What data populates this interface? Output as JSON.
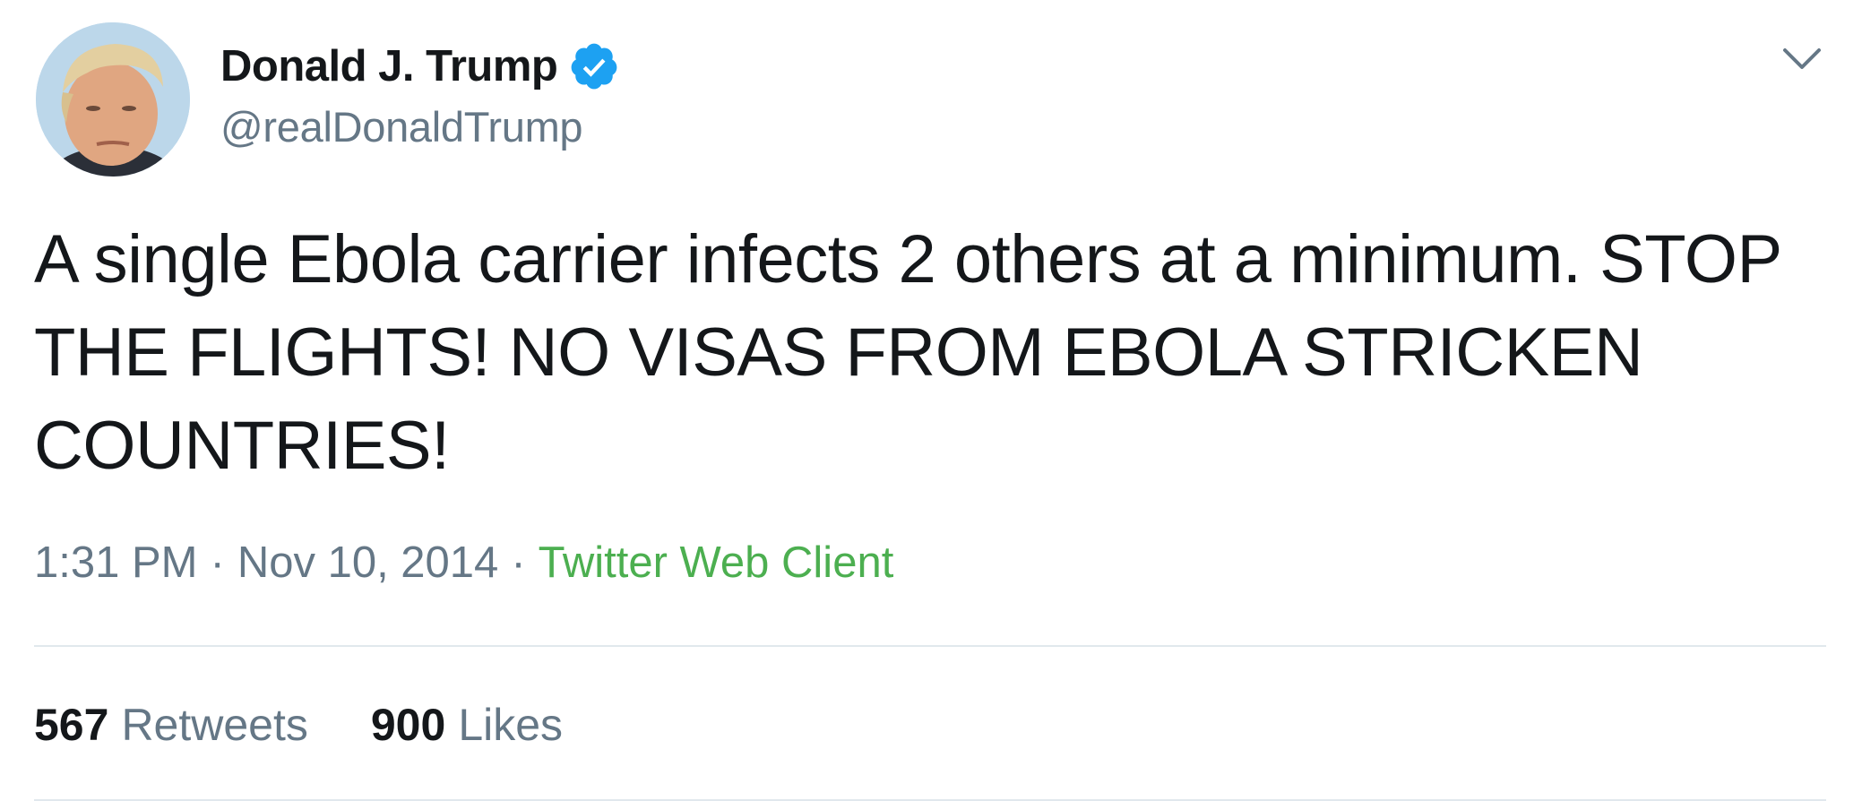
{
  "author": {
    "display_name": "Donald J. Trump",
    "handle": "@realDonaldTrump",
    "verified": true,
    "avatar": "profile-photo"
  },
  "tweet": {
    "text": "A single Ebola carrier infects 2 others at a minimum. STOP\nTHE FLIGHTS! NO VISAS FROM EBOLA STRICKEN\nCOUNTRIES!",
    "time": "1:31 PM",
    "date": "Nov 10, 2014",
    "separator": "·",
    "source": "Twitter Web Client"
  },
  "stats": {
    "retweets_count": "567",
    "retweets_label": "Retweets",
    "likes_count": "900",
    "likes_label": "Likes"
  },
  "icons": {
    "verified": "verified-badge-icon",
    "menu": "chevron-down-icon"
  },
  "colors": {
    "text_primary": "#14171a",
    "text_secondary": "#657786",
    "verified_blue": "#1da1f2",
    "source_green": "#4caf50",
    "divider": "#e1e8ed"
  }
}
